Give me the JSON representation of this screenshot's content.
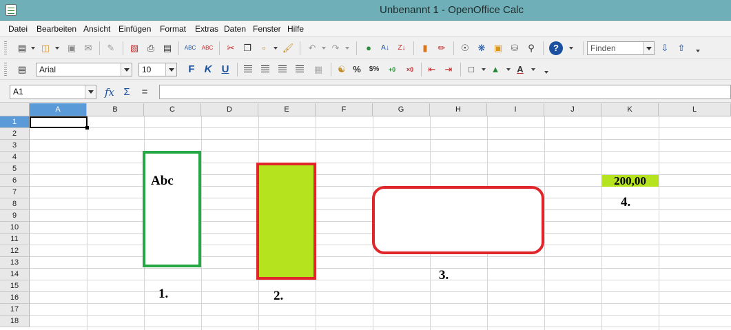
{
  "window": {
    "title": "Unbenannt 1 - OpenOffice Calc"
  },
  "menu": [
    "Datei",
    "Bearbeiten",
    "Ansicht",
    "Einfügen",
    "Format",
    "Extras",
    "Daten",
    "Fenster",
    "Hilfe"
  ],
  "toolbar": {
    "find_placeholder": "Finden"
  },
  "format_toolbar": {
    "font_name": "Arial",
    "font_size": "10"
  },
  "formula_bar": {
    "cell_ref": "A1",
    "formula": ""
  },
  "grid": {
    "columns": [
      "A",
      "B",
      "C",
      "D",
      "E",
      "F",
      "G",
      "H",
      "I",
      "J",
      "K",
      "L"
    ],
    "rows": [
      "1",
      "2",
      "3",
      "4",
      "5",
      "6",
      "7",
      "8",
      "9",
      "10",
      "11",
      "12",
      "13",
      "14",
      "15",
      "16",
      "17",
      "18"
    ],
    "active_cell": "A1"
  },
  "drawing": {
    "shape_1_text": "Abc",
    "cell_k6_value": "200,00",
    "labels": [
      "1.",
      "2.",
      "3.",
      "4."
    ],
    "colors": {
      "green_border": "#27a844",
      "red_border": "#e0262a",
      "lime_fill": "#b5e31e"
    }
  }
}
